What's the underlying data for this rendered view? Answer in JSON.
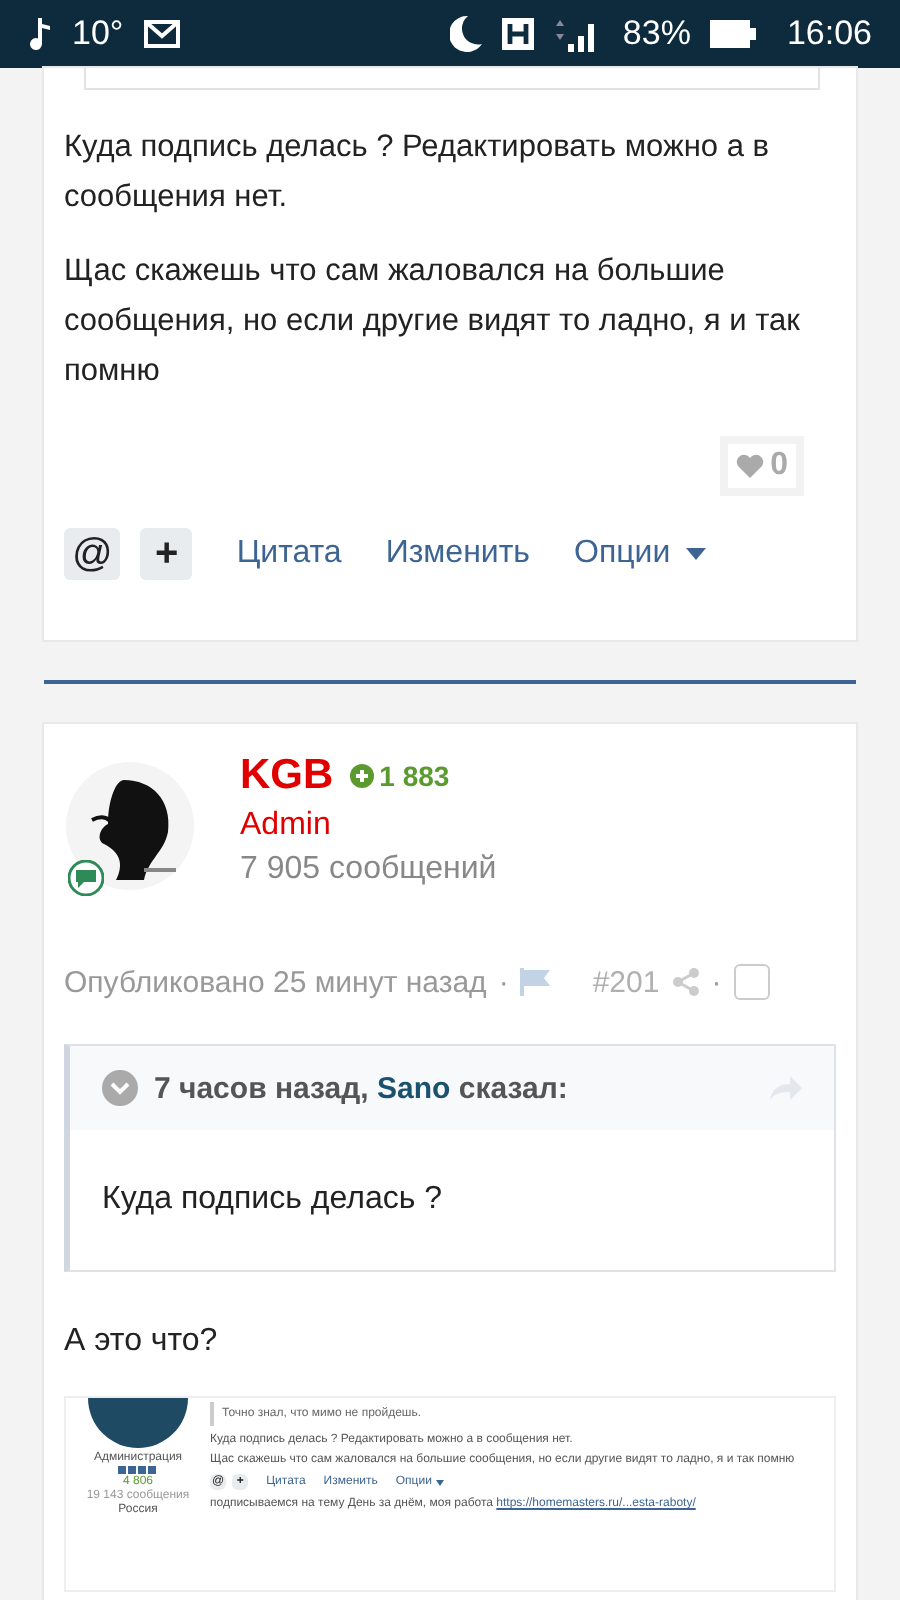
{
  "status_bar": {
    "temperature": "10°",
    "battery": "83%",
    "time": "16:06"
  },
  "post_1": {
    "paragraphs": [
      "Куда подпись делась ? Редактировать можно а в сообщения нет.",
      "Щас скажешь что сам жаловался на большие сообщения,  но если другие видят то ладно, я и так помню"
    ],
    "likes": "0",
    "actions": [
      {
        "kind": "box",
        "label": "@"
      },
      {
        "kind": "box",
        "label": "+"
      },
      {
        "kind": "link",
        "label": "Цитата"
      },
      {
        "kind": "link",
        "label": "Изменить"
      },
      {
        "kind": "menu",
        "label": "Опции"
      }
    ]
  },
  "post_2": {
    "author": "KGB",
    "reputation": "1 883",
    "role": "Admin",
    "post_count": "7 905 сообщений",
    "published": "Опубликовано 25 минут назад",
    "number": "#201",
    "separators": [
      "·",
      "·"
    ],
    "selected": false,
    "quote": {
      "time": "7 часов назад,",
      "author": "Sano",
      "said": "сказал:",
      "text": "Куда подпись делась ?"
    },
    "body": "А это что?",
    "attachment": {
      "role": "Администрация",
      "reputation": "4 806",
      "post_count": "19 143 сообщения",
      "country": "Россия",
      "quote_text": "Точно знал, что мимо не пройдешь.",
      "paragraphs": [
        "Куда подпись делась ? Редактировать можно а в сообщения нет.",
        "Щас скажешь что сам жаловался на большие сообщения,  но если другие видят то ладно, я и так помню"
      ],
      "actions": [
        {
          "kind": "box",
          "label": "@"
        },
        {
          "kind": "box",
          "label": "+"
        },
        {
          "kind": "link",
          "label": "Цитата"
        },
        {
          "kind": "link",
          "label": "Изменить"
        },
        {
          "kind": "menu",
          "label": "Опции"
        }
      ],
      "signature": "подписываемся на тему День за днём, моя работа",
      "signature_link": "https://homemasters.ru/...esta-raboty/"
    }
  }
}
